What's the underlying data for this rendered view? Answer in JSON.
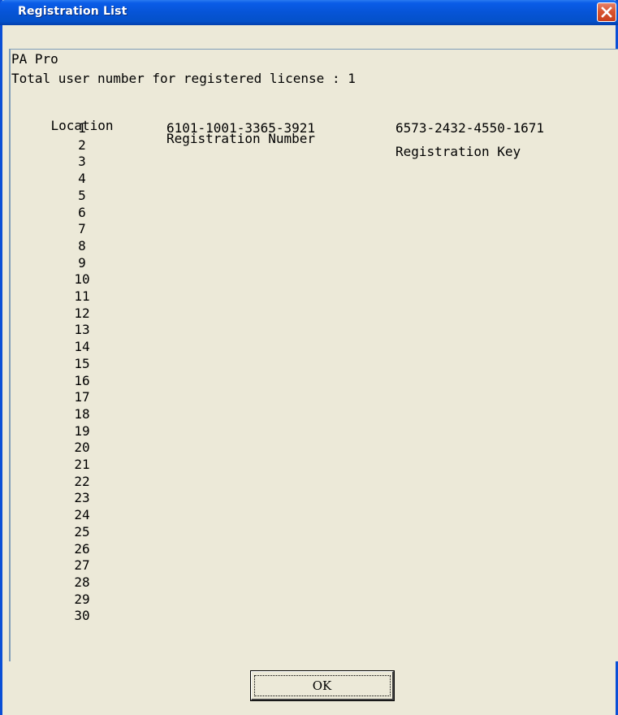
{
  "window": {
    "title": "Registration List",
    "close_label": "close"
  },
  "header": {
    "product": "PA Pro",
    "total_label": "Total user number for registered license : 1"
  },
  "table": {
    "columns": [
      "Location",
      "Registration Number",
      "Registration Key"
    ],
    "rows": [
      {
        "location": "1",
        "registration_number": "6101-1001-3365-3921",
        "registration_key": "6573-2432-4550-1671"
      },
      {
        "location": "2",
        "registration_number": "",
        "registration_key": ""
      },
      {
        "location": "3",
        "registration_number": "",
        "registration_key": ""
      },
      {
        "location": "4",
        "registration_number": "",
        "registration_key": ""
      },
      {
        "location": "5",
        "registration_number": "",
        "registration_key": ""
      },
      {
        "location": "6",
        "registration_number": "",
        "registration_key": ""
      },
      {
        "location": "7",
        "registration_number": "",
        "registration_key": ""
      },
      {
        "location": "8",
        "registration_number": "",
        "registration_key": ""
      },
      {
        "location": "9",
        "registration_number": "",
        "registration_key": ""
      },
      {
        "location": "10",
        "registration_number": "",
        "registration_key": ""
      },
      {
        "location": "11",
        "registration_number": "",
        "registration_key": ""
      },
      {
        "location": "12",
        "registration_number": "",
        "registration_key": ""
      },
      {
        "location": "13",
        "registration_number": "",
        "registration_key": ""
      },
      {
        "location": "14",
        "registration_number": "",
        "registration_key": ""
      },
      {
        "location": "15",
        "registration_number": "",
        "registration_key": ""
      },
      {
        "location": "16",
        "registration_number": "",
        "registration_key": ""
      },
      {
        "location": "17",
        "registration_number": "",
        "registration_key": ""
      },
      {
        "location": "18",
        "registration_number": "",
        "registration_key": ""
      },
      {
        "location": "19",
        "registration_number": "",
        "registration_key": ""
      },
      {
        "location": "20",
        "registration_number": "",
        "registration_key": ""
      },
      {
        "location": "21",
        "registration_number": "",
        "registration_key": ""
      },
      {
        "location": "22",
        "registration_number": "",
        "registration_key": ""
      },
      {
        "location": "23",
        "registration_number": "",
        "registration_key": ""
      },
      {
        "location": "24",
        "registration_number": "",
        "registration_key": ""
      },
      {
        "location": "25",
        "registration_number": "",
        "registration_key": ""
      },
      {
        "location": "26",
        "registration_number": "",
        "registration_key": ""
      },
      {
        "location": "27",
        "registration_number": "",
        "registration_key": ""
      },
      {
        "location": "28",
        "registration_number": "",
        "registration_key": ""
      },
      {
        "location": "29",
        "registration_number": "",
        "registration_key": ""
      },
      {
        "location": "30",
        "registration_number": "",
        "registration_key": ""
      }
    ]
  },
  "footer": {
    "ok_label": "OK"
  },
  "colors": {
    "titlebar": "#0654d6",
    "window_bg": "#ece9d8",
    "close_button": "#d8542f"
  }
}
